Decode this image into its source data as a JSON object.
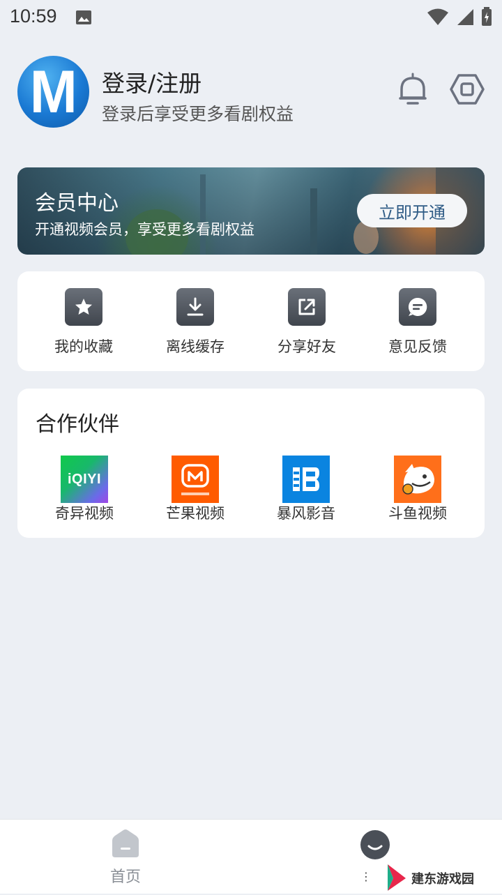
{
  "status_bar": {
    "time": "10:59"
  },
  "header": {
    "avatar_letter": "M",
    "login_title": "登录/注册",
    "login_subtitle": "登录后享受更多看剧权益"
  },
  "vip_banner": {
    "title": "会员中心",
    "subtitle": "开通视频会员，享受更多看剧权益",
    "button_label": "立即开通"
  },
  "menu": {
    "items": [
      {
        "label": "我的收藏",
        "icon": "star-icon"
      },
      {
        "label": "离线缓存",
        "icon": "download-icon"
      },
      {
        "label": "分享好友",
        "icon": "share-icon"
      },
      {
        "label": "意见反馈",
        "icon": "feedback-icon"
      }
    ]
  },
  "partners": {
    "title": "合作伙伴",
    "items": [
      {
        "label": "奇异视频",
        "logo_text": "iQIYI",
        "color": "#00be06"
      },
      {
        "label": "芒果视频",
        "logo_text": "M",
        "color": "#ff5f00"
      },
      {
        "label": "暴风影音",
        "logo_text": "",
        "color": "#0d86e8"
      },
      {
        "label": "斗鱼视频",
        "logo_text": "",
        "color": "#ff7a1a"
      }
    ]
  },
  "tab_bar": {
    "home_label": "首页"
  },
  "watermark": {
    "text": "建东游戏园"
  }
}
